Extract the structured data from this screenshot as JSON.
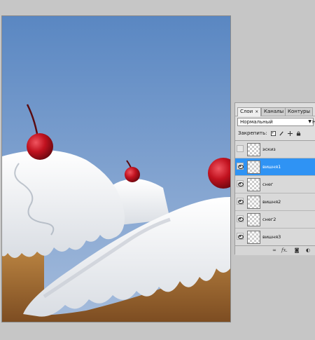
{
  "layers_panel": {
    "tabs": [
      {
        "label": "Слои",
        "active": true
      },
      {
        "label": "Каналы",
        "active": false
      },
      {
        "label": "Контуры",
        "active": false
      }
    ],
    "tab_close_glyph": "×",
    "blend_mode": "Нормальный",
    "blend_extra": "Н",
    "lock_label": "Закрепить:",
    "layers": [
      {
        "name": "эскиз",
        "visible": false,
        "selected": false
      },
      {
        "name": "вишня1",
        "visible": true,
        "selected": true
      },
      {
        "name": "снег",
        "visible": true,
        "selected": false
      },
      {
        "name": "вишня2",
        "visible": true,
        "selected": false
      },
      {
        "name": "снег2",
        "visible": true,
        "selected": false
      },
      {
        "name": "вишня3",
        "visible": true,
        "selected": false
      }
    ],
    "bottom_icons": [
      "link-icon",
      "fx-icon",
      "mask-icon",
      "adjustment-icon"
    ],
    "fx_label": "fx."
  },
  "colors": {
    "sky_top": "#5a87c2",
    "sky_bottom": "#9cb6d8",
    "selected_layer": "#2f93f4",
    "cherry": "#b50f1c",
    "frosting": "#f4f4f6",
    "cake": "#b07a3a"
  }
}
